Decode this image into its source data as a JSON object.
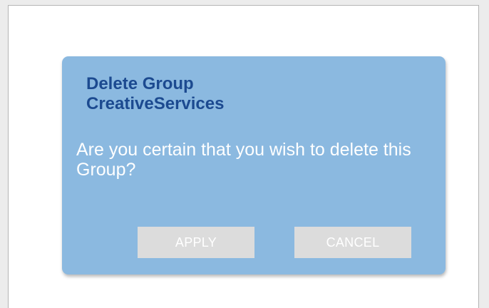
{
  "dialog": {
    "title_line1": "Delete Group",
    "title_line2": "CreativeServices",
    "message": "Are you certain that you wish to delete this Group?",
    "apply_label": "APPLY",
    "cancel_label": "CANCEL"
  },
  "colors": {
    "dialog_background": "#8bb9e0",
    "title_text": "#1c4a90",
    "message_text": "#ffffff",
    "button_background": "#dcdcdc",
    "button_text": "#ffffff"
  }
}
